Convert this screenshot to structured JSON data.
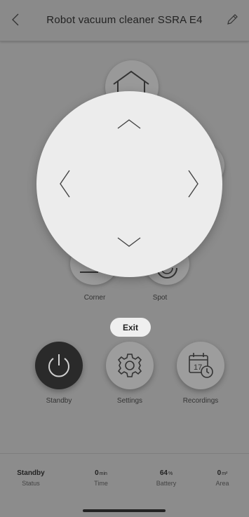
{
  "header": {
    "title": "Robot vacuum cleaner SSRA E4",
    "back_icon": "chevron-left-icon",
    "edit_icon": "pencil-icon"
  },
  "modes": {
    "corner_label": "Corner",
    "spot_label": "Spot"
  },
  "exit_label": "Exit",
  "actions": [
    {
      "label": "Standby",
      "icon": "power-icon"
    },
    {
      "label": "Settings",
      "icon": "gear-icon"
    },
    {
      "label": "Recordings",
      "icon": "calendar-clock-icon",
      "calendar_day": "17"
    }
  ],
  "stats": [
    {
      "value": "Standby",
      "unit": "",
      "label": "Status"
    },
    {
      "value": "0",
      "unit": "min",
      "label": "Time"
    },
    {
      "value": "64",
      "unit": "%",
      "label": "Battery"
    },
    {
      "value": "0",
      "unit": "m²",
      "label": "Area"
    }
  ]
}
